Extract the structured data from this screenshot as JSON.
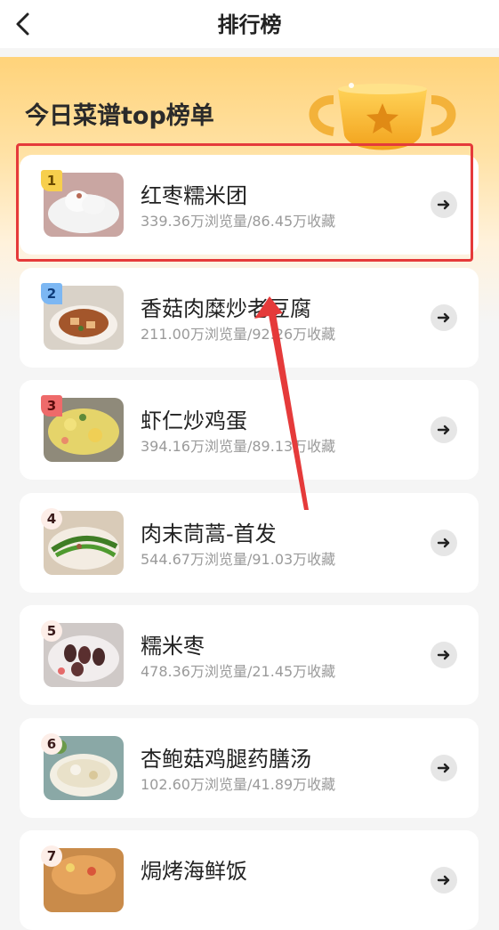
{
  "header": {
    "title": "排行榜",
    "back_icon": "chevron-left-icon"
  },
  "hero": {
    "title": "今日菜谱top榜单",
    "trophy_icon": "trophy-icon"
  },
  "colors": {
    "rank1": "#f7cf4d",
    "rank2": "#7cb7f3",
    "rank3": "#ee6a6a",
    "highlight": "#e53a3a"
  },
  "recipes": [
    {
      "rank": "1",
      "name": "红枣糯米团",
      "stats": "339.36万浏览量/86.45万收藏"
    },
    {
      "rank": "2",
      "name": "香菇肉糜炒老豆腐",
      "stats": "211.00万浏览量/92.26万收藏"
    },
    {
      "rank": "3",
      "name": "虾仁炒鸡蛋",
      "stats": "394.16万浏览量/89.13万收藏"
    },
    {
      "rank": "4",
      "name": "肉末茼蒿-首发",
      "stats": "544.67万浏览量/91.03万收藏"
    },
    {
      "rank": "5",
      "name": "糯米枣",
      "stats": "478.36万浏览量/21.45万收藏"
    },
    {
      "rank": "6",
      "name": "杏鲍菇鸡腿药膳汤",
      "stats": "102.60万浏览量/41.89万收藏"
    },
    {
      "rank": "7",
      "name": "焗烤海鲜饭",
      "stats": ""
    }
  ]
}
